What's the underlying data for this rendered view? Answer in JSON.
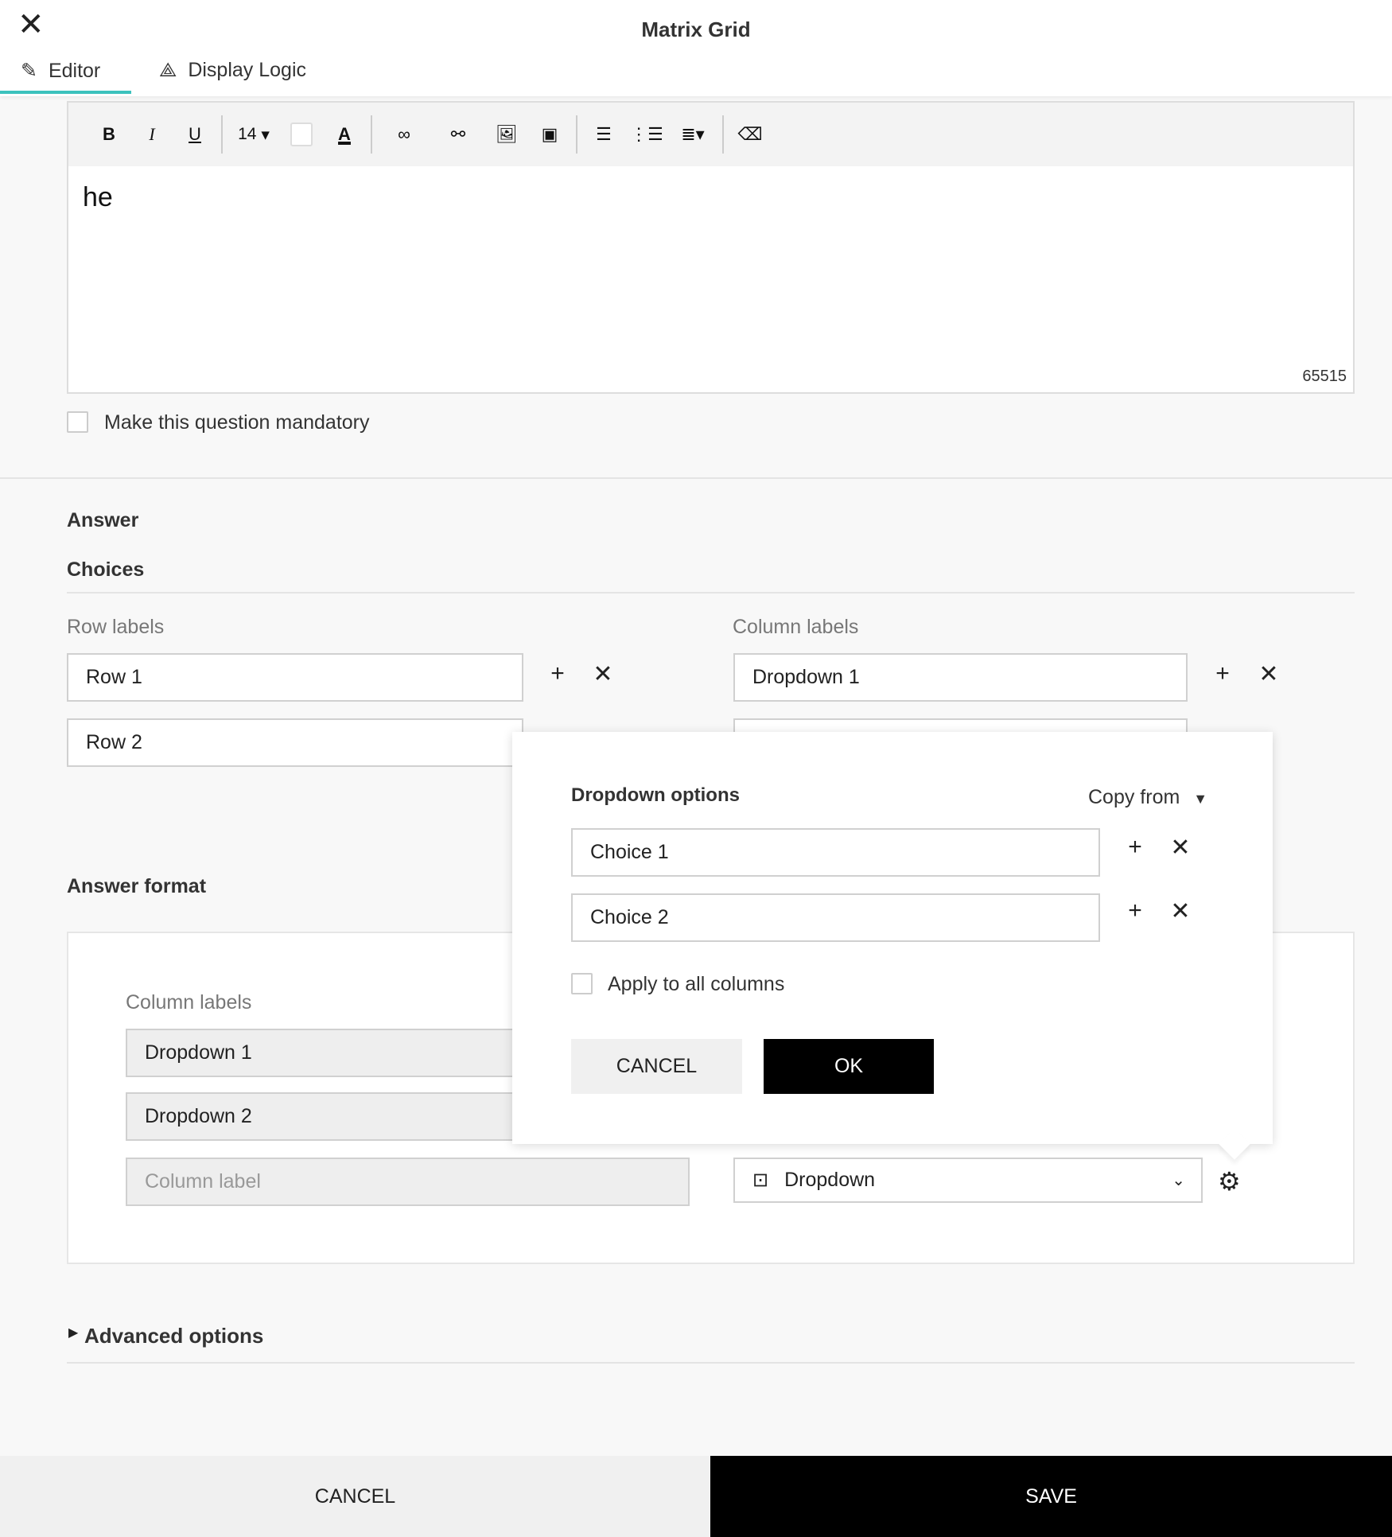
{
  "header": {
    "title": "Matrix Grid",
    "tabs": [
      {
        "label": "Editor",
        "icon": "pencil-icon"
      },
      {
        "label": "Display Logic",
        "icon": "logic-icon"
      }
    ]
  },
  "editor": {
    "font_size": "14",
    "content": "he",
    "char_counter": "65515"
  },
  "mandatory_label": "Make this question mandatory",
  "answer": {
    "heading": "Answer",
    "choices_heading": "Choices",
    "row_labels_title": "Row labels",
    "column_labels_title": "Column labels",
    "rows": [
      "Row 1",
      "Row 2"
    ],
    "columns": [
      "Dropdown 1"
    ]
  },
  "answer_format": {
    "heading": "Answer format",
    "column_labels_title": "Column labels",
    "columns": [
      "Dropdown 1",
      "Dropdown 2"
    ],
    "new_column_placeholder": "Column label",
    "format_select": "Dropdown"
  },
  "popup": {
    "title": "Dropdown options",
    "copy_from": "Copy from",
    "choices": [
      "Choice 1",
      "Choice 2"
    ],
    "apply_all": "Apply to all columns",
    "cancel": "CANCEL",
    "ok": "OK"
  },
  "advanced": "Advanced options",
  "footer": {
    "cancel": "CANCEL",
    "save": "SAVE"
  },
  "colors": {
    "accent": "#3cc2bd"
  }
}
